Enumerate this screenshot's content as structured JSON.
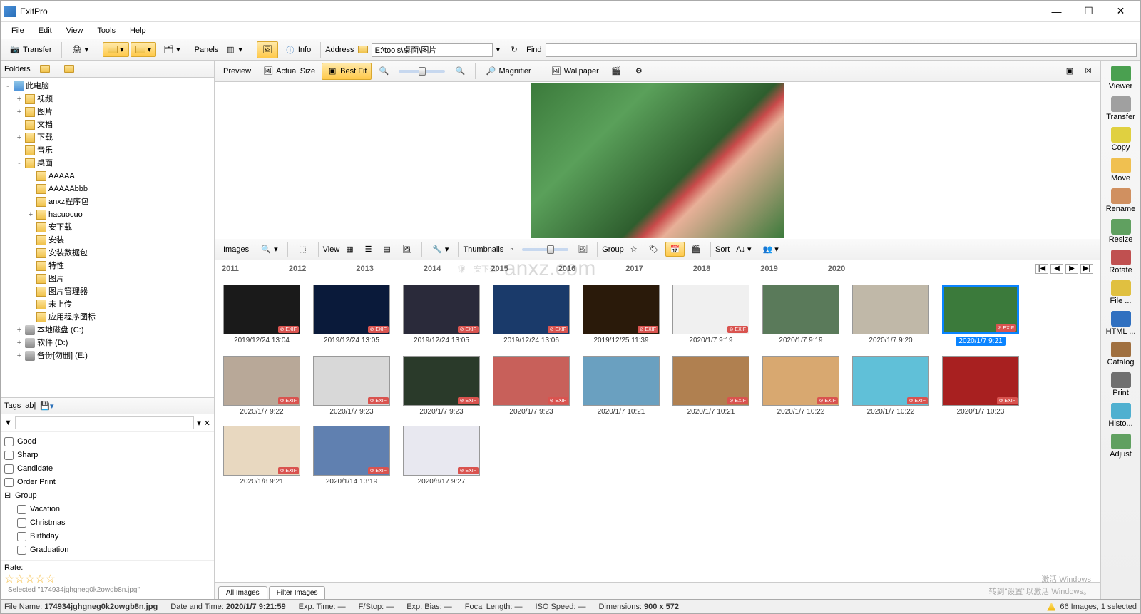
{
  "title": "ExifPro",
  "menu": [
    "File",
    "Edit",
    "View",
    "Tools",
    "Help"
  ],
  "toolbar": {
    "transfer": "Transfer",
    "panels": "Panels",
    "info": "Info",
    "address_label": "Address",
    "address_value": "E:\\tools\\桌面\\图片",
    "find_label": "Find"
  },
  "folders": {
    "header": "Folders",
    "tree": [
      {
        "level": 0,
        "exp": "-",
        "icon": "pc",
        "label": "此电脑"
      },
      {
        "level": 1,
        "exp": "+",
        "icon": "fld",
        "label": "视频"
      },
      {
        "level": 1,
        "exp": "+",
        "icon": "fld",
        "label": "图片"
      },
      {
        "level": 1,
        "exp": "",
        "icon": "fld",
        "label": "文档"
      },
      {
        "level": 1,
        "exp": "+",
        "icon": "fld",
        "label": "下载"
      },
      {
        "level": 1,
        "exp": "",
        "icon": "fld",
        "label": "音乐"
      },
      {
        "level": 1,
        "exp": "-",
        "icon": "fld",
        "label": "桌面"
      },
      {
        "level": 2,
        "exp": "",
        "icon": "fld",
        "label": "AAAAA"
      },
      {
        "level": 2,
        "exp": "",
        "icon": "fld",
        "label": "AAAAAbbb"
      },
      {
        "level": 2,
        "exp": "",
        "icon": "fld",
        "label": "anxz程序包"
      },
      {
        "level": 2,
        "exp": "+",
        "icon": "fld",
        "label": "hacuocuo"
      },
      {
        "level": 2,
        "exp": "",
        "icon": "fld",
        "label": "安下载"
      },
      {
        "level": 2,
        "exp": "",
        "icon": "fld",
        "label": "安装"
      },
      {
        "level": 2,
        "exp": "",
        "icon": "fld",
        "label": "安装数据包"
      },
      {
        "level": 2,
        "exp": "",
        "icon": "fld",
        "label": "特性"
      },
      {
        "level": 2,
        "exp": "",
        "icon": "fld",
        "label": "图片"
      },
      {
        "level": 2,
        "exp": "",
        "icon": "fld",
        "label": "图片管理器"
      },
      {
        "level": 2,
        "exp": "",
        "icon": "fld",
        "label": "未上传"
      },
      {
        "level": 2,
        "exp": "",
        "icon": "fld",
        "label": "应用程序图标"
      },
      {
        "level": 1,
        "exp": "+",
        "icon": "drv",
        "label": "本地磁盘 (C:)"
      },
      {
        "level": 1,
        "exp": "+",
        "icon": "drv",
        "label": "软件 (D:)"
      },
      {
        "level": 1,
        "exp": "+",
        "icon": "drv",
        "label": "备份[勿删] (E:)"
      }
    ]
  },
  "tags": {
    "header": "Tags",
    "filter_placeholder": "▼",
    "items": [
      "Good",
      "Sharp",
      "Candidate",
      "Order Print"
    ],
    "group_label": "Group",
    "group_items": [
      "Vacation",
      "Christmas",
      "Birthday",
      "Graduation"
    ],
    "rate_label": "Rate:",
    "selected_hint": "Selected \"174934jghgneg0k2owgb8n.jpg\""
  },
  "preview_bar": {
    "preview": "Preview",
    "actual_size": "Actual Size",
    "best_fit": "Best Fit",
    "magnifier": "Magnifier",
    "wallpaper": "Wallpaper"
  },
  "images_bar": {
    "images": "Images",
    "view": "View",
    "thumbnails": "Thumbnails",
    "group": "Group",
    "sort": "Sort"
  },
  "timeline": [
    "2011",
    "2012",
    "2013",
    "2014",
    "2015",
    "2016",
    "2017",
    "2018",
    "2019",
    "2020"
  ],
  "thumbnails": [
    {
      "date": "2019/12/24  13:04",
      "exif": true,
      "bg": "#1a1a1a"
    },
    {
      "date": "2019/12/24  13:05",
      "exif": true,
      "bg": "#0a1a3a"
    },
    {
      "date": "2019/12/24  13:05",
      "exif": true,
      "bg": "#2a2a3a"
    },
    {
      "date": "2019/12/24  13:06",
      "exif": true,
      "bg": "#1a3a6a"
    },
    {
      "date": "2019/12/25  11:39",
      "exif": true,
      "bg": "#2a1a0a"
    },
    {
      "date": "2020/1/7  9:19",
      "exif": true,
      "bg": "#f0f0f0"
    },
    {
      "date": "2020/1/7  9:19",
      "exif": false,
      "bg": "#5a7a5a"
    },
    {
      "date": "2020/1/7  9:20",
      "exif": false,
      "bg": "#c0b8a8"
    },
    {
      "date": "2020/1/7  9:21",
      "exif": true,
      "bg": "#3b7a3b",
      "selected": true
    },
    {
      "date": "2020/1/7  9:22",
      "exif": true,
      "bg": "#b8a898"
    },
    {
      "date": "2020/1/7  9:23",
      "exif": true,
      "bg": "#d8d8d8"
    },
    {
      "date": "2020/1/7  9:23",
      "exif": true,
      "bg": "#2a3a2a"
    },
    {
      "date": "2020/1/7  9:23",
      "exif": true,
      "bg": "#c8605a"
    },
    {
      "date": "2020/1/7  10:21",
      "exif": false,
      "bg": "#6aa0c0"
    },
    {
      "date": "2020/1/7  10:21",
      "exif": true,
      "bg": "#b08050"
    },
    {
      "date": "2020/1/7  10:22",
      "exif": true,
      "bg": "#d8a870"
    },
    {
      "date": "2020/1/7  10:22",
      "exif": true,
      "bg": "#60c0d8"
    },
    {
      "date": "2020/1/7  10:23",
      "exif": true,
      "bg": "#a82020"
    },
    {
      "date": "2020/1/8  9:21",
      "exif": true,
      "bg": "#e8d8c0"
    },
    {
      "date": "2020/1/14  13:19",
      "exif": true,
      "bg": "#6080b0"
    },
    {
      "date": "2020/8/17  9:27",
      "exif": true,
      "bg": "#e8e8f0"
    }
  ],
  "tabs": [
    "All Images",
    "Filter Images"
  ],
  "sidebar": [
    {
      "label": "Viewer",
      "color": "#4aa050"
    },
    {
      "label": "Transfer",
      "color": "#a0a0a0"
    },
    {
      "label": "Copy",
      "color": "#e0d040"
    },
    {
      "label": "Move",
      "color": "#f0c050"
    },
    {
      "label": "Rename",
      "color": "#d09060"
    },
    {
      "label": "Resize",
      "color": "#60a060"
    },
    {
      "label": "Rotate",
      "color": "#c05050"
    },
    {
      "label": "File ...",
      "color": "#e0c040"
    },
    {
      "label": "HTML ...",
      "color": "#3070c0"
    },
    {
      "label": "Catalog",
      "color": "#a07040"
    },
    {
      "label": "Print",
      "color": "#707070"
    },
    {
      "label": "Histo...",
      "color": "#50b0d0"
    },
    {
      "label": "Adjust",
      "color": "#60a060"
    }
  ],
  "status": {
    "file_label": "File Name:",
    "file_value": "174934jghgneg0k2owgb8n.jpg",
    "dt_label": "Date and Time:",
    "dt_value": "2020/1/7  9:21:59",
    "exp_label": "Exp. Time:",
    "exp_value": "—",
    "fstop_label": "F/Stop:",
    "fstop_value": "—",
    "bias_label": "Exp. Bias:",
    "bias_value": "—",
    "focal_label": "Focal Length:",
    "focal_value": "—",
    "iso_label": "ISO Speed:",
    "iso_value": "—",
    "dim_label": "Dimensions:",
    "dim_value": "900 x 572",
    "count": "66 Images, 1 selected"
  },
  "watermark": "安下载",
  "activate_windows": "激活 Windows",
  "activate_hint": "转到\"设置\"以激活 Windows。"
}
